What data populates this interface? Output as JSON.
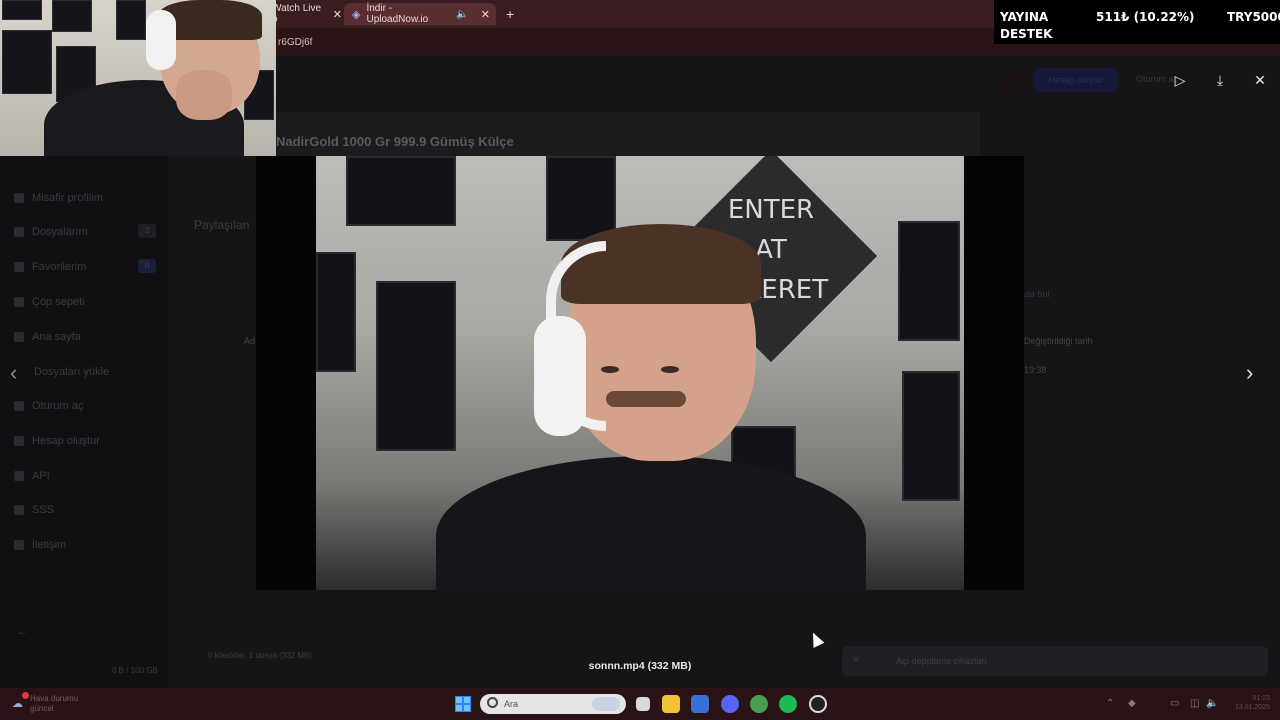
{
  "browser": {
    "tabs": [
      {
        "label": "Watch Live o",
        "active": false
      },
      {
        "label": "İndir - UploadNow.io",
        "active": true
      }
    ],
    "url_fragment": "r6GDj6f",
    "new_tab_glyph": "+"
  },
  "donation": {
    "line1": "YAYINA",
    "line2": "DESTEK",
    "amount": "511₺ (10.22%)",
    "target": "TRY5000"
  },
  "site": {
    "header": {
      "register": "Hesap oluştur",
      "login": "Oturum aç"
    },
    "sidebar": {
      "items": [
        {
          "label": "Misafir profilim"
        },
        {
          "label": "Dosyalarım",
          "count": "3"
        },
        {
          "label": "Favorilerim",
          "count": "0"
        },
        {
          "label": "Çöp sepeti"
        },
        {
          "label": "Ana sayfa"
        },
        {
          "label": "Dosyaları yükle"
        },
        {
          "label": "Oturum aç"
        },
        {
          "label": "Hesap oluştur"
        },
        {
          "label": "API"
        },
        {
          "label": "SSS"
        },
        {
          "label": "İletişim"
        }
      ],
      "storage": "0 B / 100 GB"
    },
    "main": {
      "heading": "Paylaşılan",
      "search_hint": "ada bul",
      "col_name": "Ad",
      "col_modified": "Değiştirildiği tarih",
      "row_time": "19:38",
      "summary": "0 klasörler, 1 dosya (332 MB)"
    }
  },
  "viewer": {
    "title": "NadirGold 1000 Gr 999.9 Gümüş Külçe",
    "video_poster_text": "ENTER AT FAKERET",
    "filename": "sonnn.mp4",
    "filesize": "(332 MB)",
    "caption": "sonnn.mp4  (332 MB)",
    "toast": "Açı depolama cihazları"
  },
  "taskbar": {
    "search_placeholder": "Ara",
    "weather": "Hava durumu",
    "weather_sub": "güncel",
    "clock_time": "01:23",
    "clock_date": "13.01.2025",
    "apps": [
      {
        "icon": "file-explorer-icon",
        "color": "#f0c238"
      },
      {
        "icon": "microsoft-store-icon",
        "color": "#3a6fd6"
      },
      {
        "icon": "discord-icon",
        "color": "#5865f2"
      },
      {
        "icon": "chrome-icon",
        "color": "#4a9e50"
      },
      {
        "icon": "spotify-icon",
        "color": "#1db954"
      },
      {
        "icon": "steam-icon",
        "color": "#222"
      }
    ]
  }
}
